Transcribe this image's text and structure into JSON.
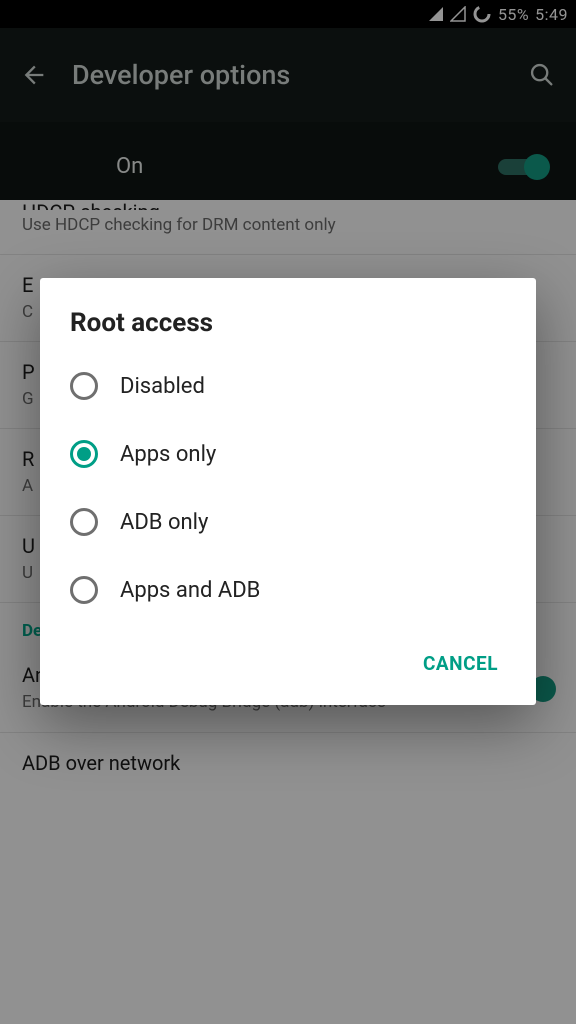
{
  "status": {
    "battery": "55%",
    "clock": "5:49"
  },
  "appbar": {
    "title": "Developer options"
  },
  "master": {
    "label": "On"
  },
  "settings": {
    "hdcp": {
      "title": "HDCP checking",
      "sub": "Use HDCP checking for DRM content only"
    },
    "e": {
      "title": "E",
      "sub": "C"
    },
    "p": {
      "title": "P",
      "sub": "G"
    },
    "r": {
      "title": "R",
      "sub": "A"
    },
    "u": {
      "title": "U",
      "sub": "U"
    },
    "section_debugging": "Debugging",
    "adbg": {
      "title": "Android debugging",
      "sub": "Enable the Android Debug Bridge (adb) interface"
    },
    "adbnet": {
      "title": "ADB over network",
      "sub": ""
    }
  },
  "dialog": {
    "title": "Root access",
    "options": {
      "o0": "Disabled",
      "o1": "Apps only",
      "o2": "ADB only",
      "o3": "Apps and ADB"
    },
    "selected_index": 1,
    "cancel": "CANCEL"
  }
}
